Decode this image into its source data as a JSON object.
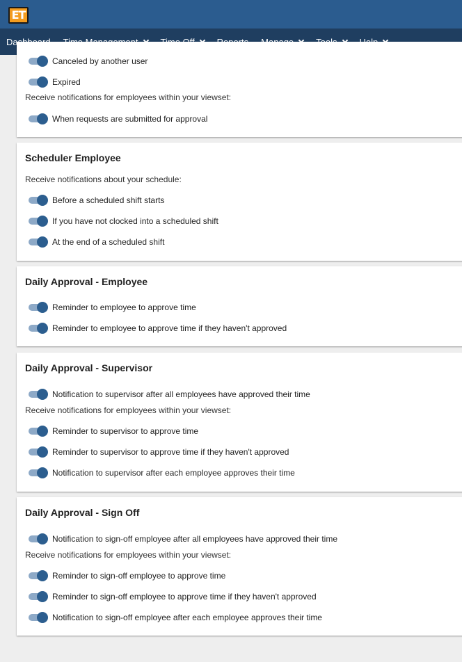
{
  "logo": {
    "text": "ET"
  },
  "nav": {
    "dashboard": "Dashboard",
    "time_management": "Time Management",
    "time_off": "Time Off",
    "reports": "Reports",
    "manage": "Manage",
    "tools": "Tools",
    "help": "Help"
  },
  "colors": {
    "topbar": "#2b5c8f",
    "nav": "#1f3e60",
    "toggle_knob": "#2c5e8f",
    "toggle_track": "#8da9c7",
    "logo": "#f39c1f"
  },
  "sections": [
    {
      "title": "",
      "items": [
        {
          "type": "toggle",
          "label": "Canceled by another user",
          "on": true
        },
        {
          "type": "toggle",
          "label": "Expired",
          "on": true
        },
        {
          "type": "caption",
          "label": "Receive notifications for employees within your viewset:"
        },
        {
          "type": "toggle",
          "label": "When requests are submitted for approval",
          "on": true
        }
      ]
    },
    {
      "title": "Scheduler Employee",
      "items": [
        {
          "type": "caption",
          "label": "Receive notifications about your schedule:"
        },
        {
          "type": "toggle",
          "label": "Before a scheduled shift starts",
          "on": true
        },
        {
          "type": "toggle",
          "label": "If you have not clocked into a scheduled shift",
          "on": true
        },
        {
          "type": "toggle",
          "label": "At the end of a scheduled shift",
          "on": true
        }
      ]
    },
    {
      "title": "Daily Approval - Employee",
      "items": [
        {
          "type": "toggle",
          "label": "Reminder to employee to approve time",
          "on": true
        },
        {
          "type": "toggle",
          "label": "Reminder to employee to approve time if they haven't approved",
          "on": true
        }
      ]
    },
    {
      "title": "Daily Approval - Supervisor",
      "items": [
        {
          "type": "toggle",
          "label": "Notification to supervisor after all employees have approved their time",
          "on": true
        },
        {
          "type": "caption",
          "label": "Receive notifications for employees within your viewset:"
        },
        {
          "type": "toggle",
          "label": "Reminder to supervisor to approve time",
          "on": true
        },
        {
          "type": "toggle",
          "label": "Reminder to supervisor to approve time if they haven't approved",
          "on": true
        },
        {
          "type": "toggle",
          "label": "Notification to supervisor after each employee approves their time",
          "on": true
        }
      ]
    },
    {
      "title": "Daily Approval - Sign Off",
      "items": [
        {
          "type": "toggle",
          "label": "Notification to sign-off employee after all employees have approved their time",
          "on": true
        },
        {
          "type": "caption",
          "label": "Receive notifications for employees within your viewset:"
        },
        {
          "type": "toggle",
          "label": "Reminder to sign-off employee to approve time",
          "on": true
        },
        {
          "type": "toggle",
          "label": "Reminder to sign-off employee to approve time if they haven't approved",
          "on": true
        },
        {
          "type": "toggle",
          "label": "Notification to sign-off employee after each employee approves their time",
          "on": true
        }
      ]
    }
  ]
}
